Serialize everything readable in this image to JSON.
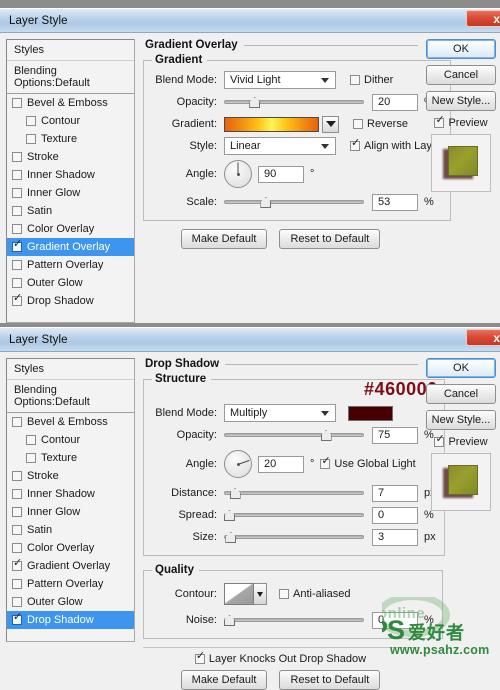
{
  "window": {
    "title": "Layer Style",
    "close_label": "x"
  },
  "styles_panel": {
    "header": "Styles",
    "blending_options": "Blending Options:Default",
    "items": [
      {
        "label": "Bevel & Emboss",
        "checked": false,
        "sub": false
      },
      {
        "label": "Contour",
        "checked": false,
        "sub": true
      },
      {
        "label": "Texture",
        "checked": false,
        "sub": true
      },
      {
        "label": "Stroke",
        "checked": false,
        "sub": false
      },
      {
        "label": "Inner Shadow",
        "checked": false,
        "sub": false
      },
      {
        "label": "Inner Glow",
        "checked": false,
        "sub": false
      },
      {
        "label": "Satin",
        "checked": false,
        "sub": false
      },
      {
        "label": "Color Overlay",
        "checked": false,
        "sub": false
      },
      {
        "label": "Gradient Overlay",
        "checked": true,
        "sub": false
      },
      {
        "label": "Pattern Overlay",
        "checked": false,
        "sub": false
      },
      {
        "label": "Outer Glow",
        "checked": false,
        "sub": false
      },
      {
        "label": "Drop Shadow",
        "checked": true,
        "sub": false
      }
    ],
    "selected_dialog1": "Gradient Overlay",
    "selected_dialog2": "Drop Shadow"
  },
  "buttons": {
    "ok": "OK",
    "cancel": "Cancel",
    "new_style": "New Style...",
    "preview": "Preview",
    "make_default": "Make Default",
    "reset_to_default": "Reset to Default"
  },
  "dialog1": {
    "section_title": "Gradient Overlay",
    "group_title": "Gradient",
    "blend_mode_label": "Blend Mode:",
    "blend_mode_value": "Vivid Light",
    "dither_label": "Dither",
    "dither_checked": false,
    "opacity_label": "Opacity:",
    "opacity_value": "20",
    "opacity_unit": "%",
    "opacity_pct": 20,
    "gradient_label": "Gradient:",
    "reverse_label": "Reverse",
    "reverse_checked": false,
    "style_label": "Style:",
    "style_value": "Linear",
    "align_label": "Align with Layer",
    "align_checked": true,
    "angle_label": "Angle:",
    "angle_value": "90",
    "angle_unit": "°",
    "angle_deg": 90,
    "scale_label": "Scale:",
    "scale_value": "53",
    "scale_unit": "%",
    "scale_pct": 28,
    "gradient_colors": [
      "#e8620a",
      "#fdc413",
      "#fff45a",
      "#e8620a"
    ]
  },
  "dialog2": {
    "section_title": "Drop Shadow",
    "group_structure": "Structure",
    "group_quality": "Quality",
    "hex_annotation": "#460000",
    "blend_mode_label": "Blend Mode:",
    "blend_mode_value": "Multiply",
    "shadow_color": "#460000",
    "opacity_label": "Opacity:",
    "opacity_value": "75",
    "opacity_unit": "%",
    "opacity_pct": 75,
    "angle_label": "Angle:",
    "angle_value": "20",
    "angle_unit": "°",
    "angle_deg": 20,
    "global_light_label": "Use Global Light",
    "global_light_checked": true,
    "distance_label": "Distance:",
    "distance_value": "7",
    "distance_unit": "px",
    "distance_pct": 5,
    "spread_label": "Spread:",
    "spread_value": "0",
    "spread_unit": "%",
    "spread_pct": 0,
    "size_label": "Size:",
    "size_value": "3",
    "size_unit": "px",
    "size_pct": 2,
    "contour_label": "Contour:",
    "antialiased_label": "Anti-aliased",
    "antialiased_checked": false,
    "noise_label": "Noise:",
    "noise_value": "0",
    "noise_unit": "%",
    "noise_pct": 0,
    "knockout_label": "Layer Knocks Out Drop Shadow",
    "knockout_checked": true
  },
  "watermark": {
    "online": "online",
    "ps": "PS",
    "chinese": "爱好者",
    "url": "www.psahz.com"
  }
}
